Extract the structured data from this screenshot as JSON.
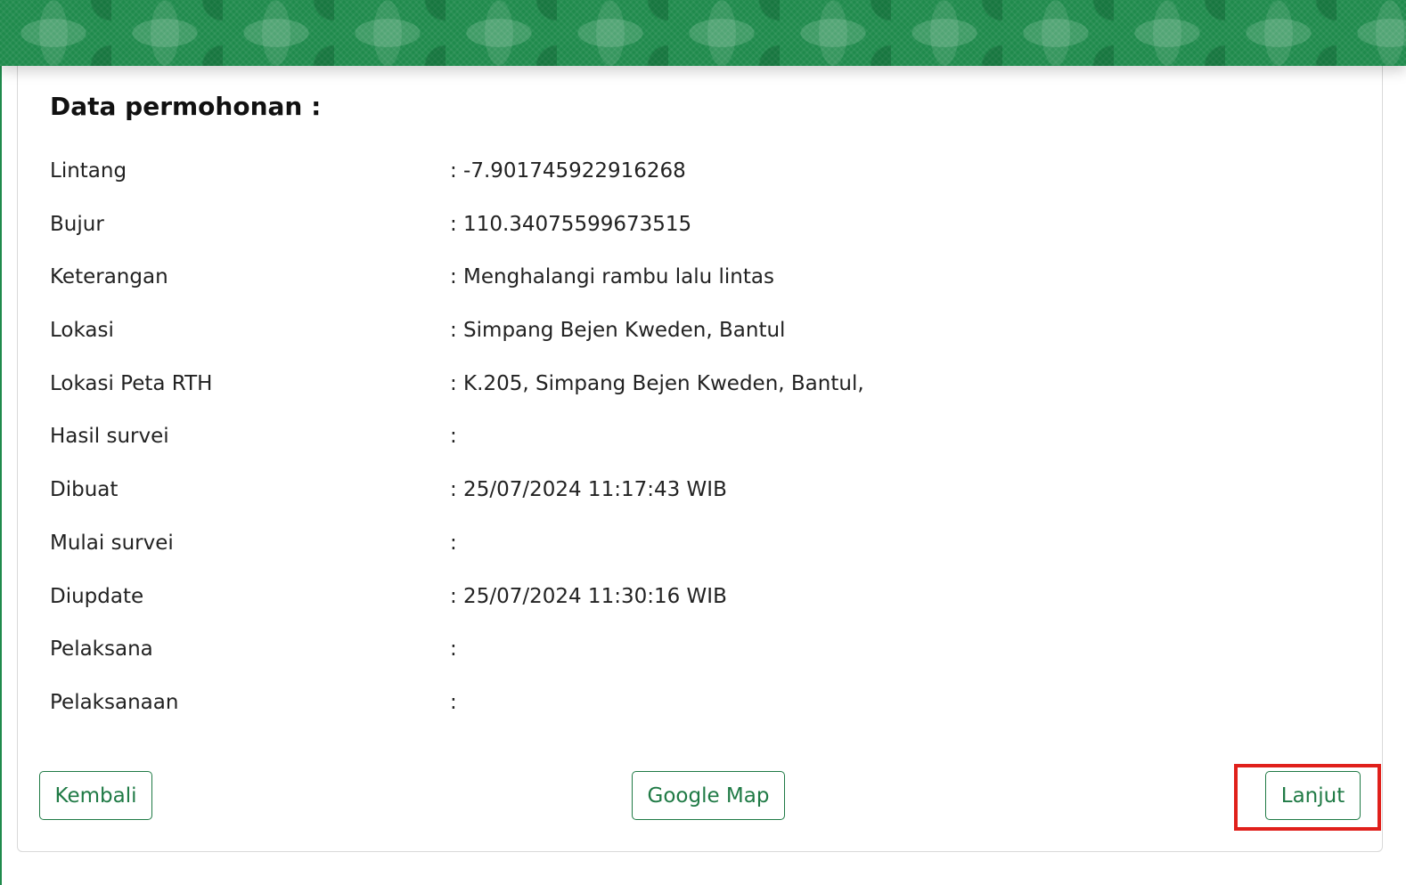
{
  "section_title": "Data permohonan :",
  "details": [
    {
      "label": "Lintang",
      "value": ": -7.901745922916268"
    },
    {
      "label": "Bujur",
      "value": ": 110.34075599673515"
    },
    {
      "label": "Keterangan",
      "value": ": Menghalangi rambu lalu lintas"
    },
    {
      "label": "Lokasi",
      "value": ": Simpang Bejen Kweden, Bantul"
    },
    {
      "label": "Lokasi Peta RTH",
      "value": ": K.205, Simpang Bejen Kweden, Bantul,"
    },
    {
      "label": "Hasil survei",
      "value": ":"
    },
    {
      "label": "Dibuat",
      "value": ": 25/07/2024 11:17:43 WIB"
    },
    {
      "label": "Mulai survei",
      "value": ":"
    },
    {
      "label": "Diupdate",
      "value": ": 25/07/2024 11:30:16 WIB"
    },
    {
      "label": "Pelaksana",
      "value": ":"
    },
    {
      "label": "Pelaksanaan",
      "value": ":"
    }
  ],
  "actions": {
    "back_label": "Kembali",
    "map_label": "Google Map",
    "next_label": "Lanjut"
  },
  "colors": {
    "brand_green": "#1f8a4c",
    "button_green": "#1f7a45",
    "highlight_red": "#e0201b"
  }
}
